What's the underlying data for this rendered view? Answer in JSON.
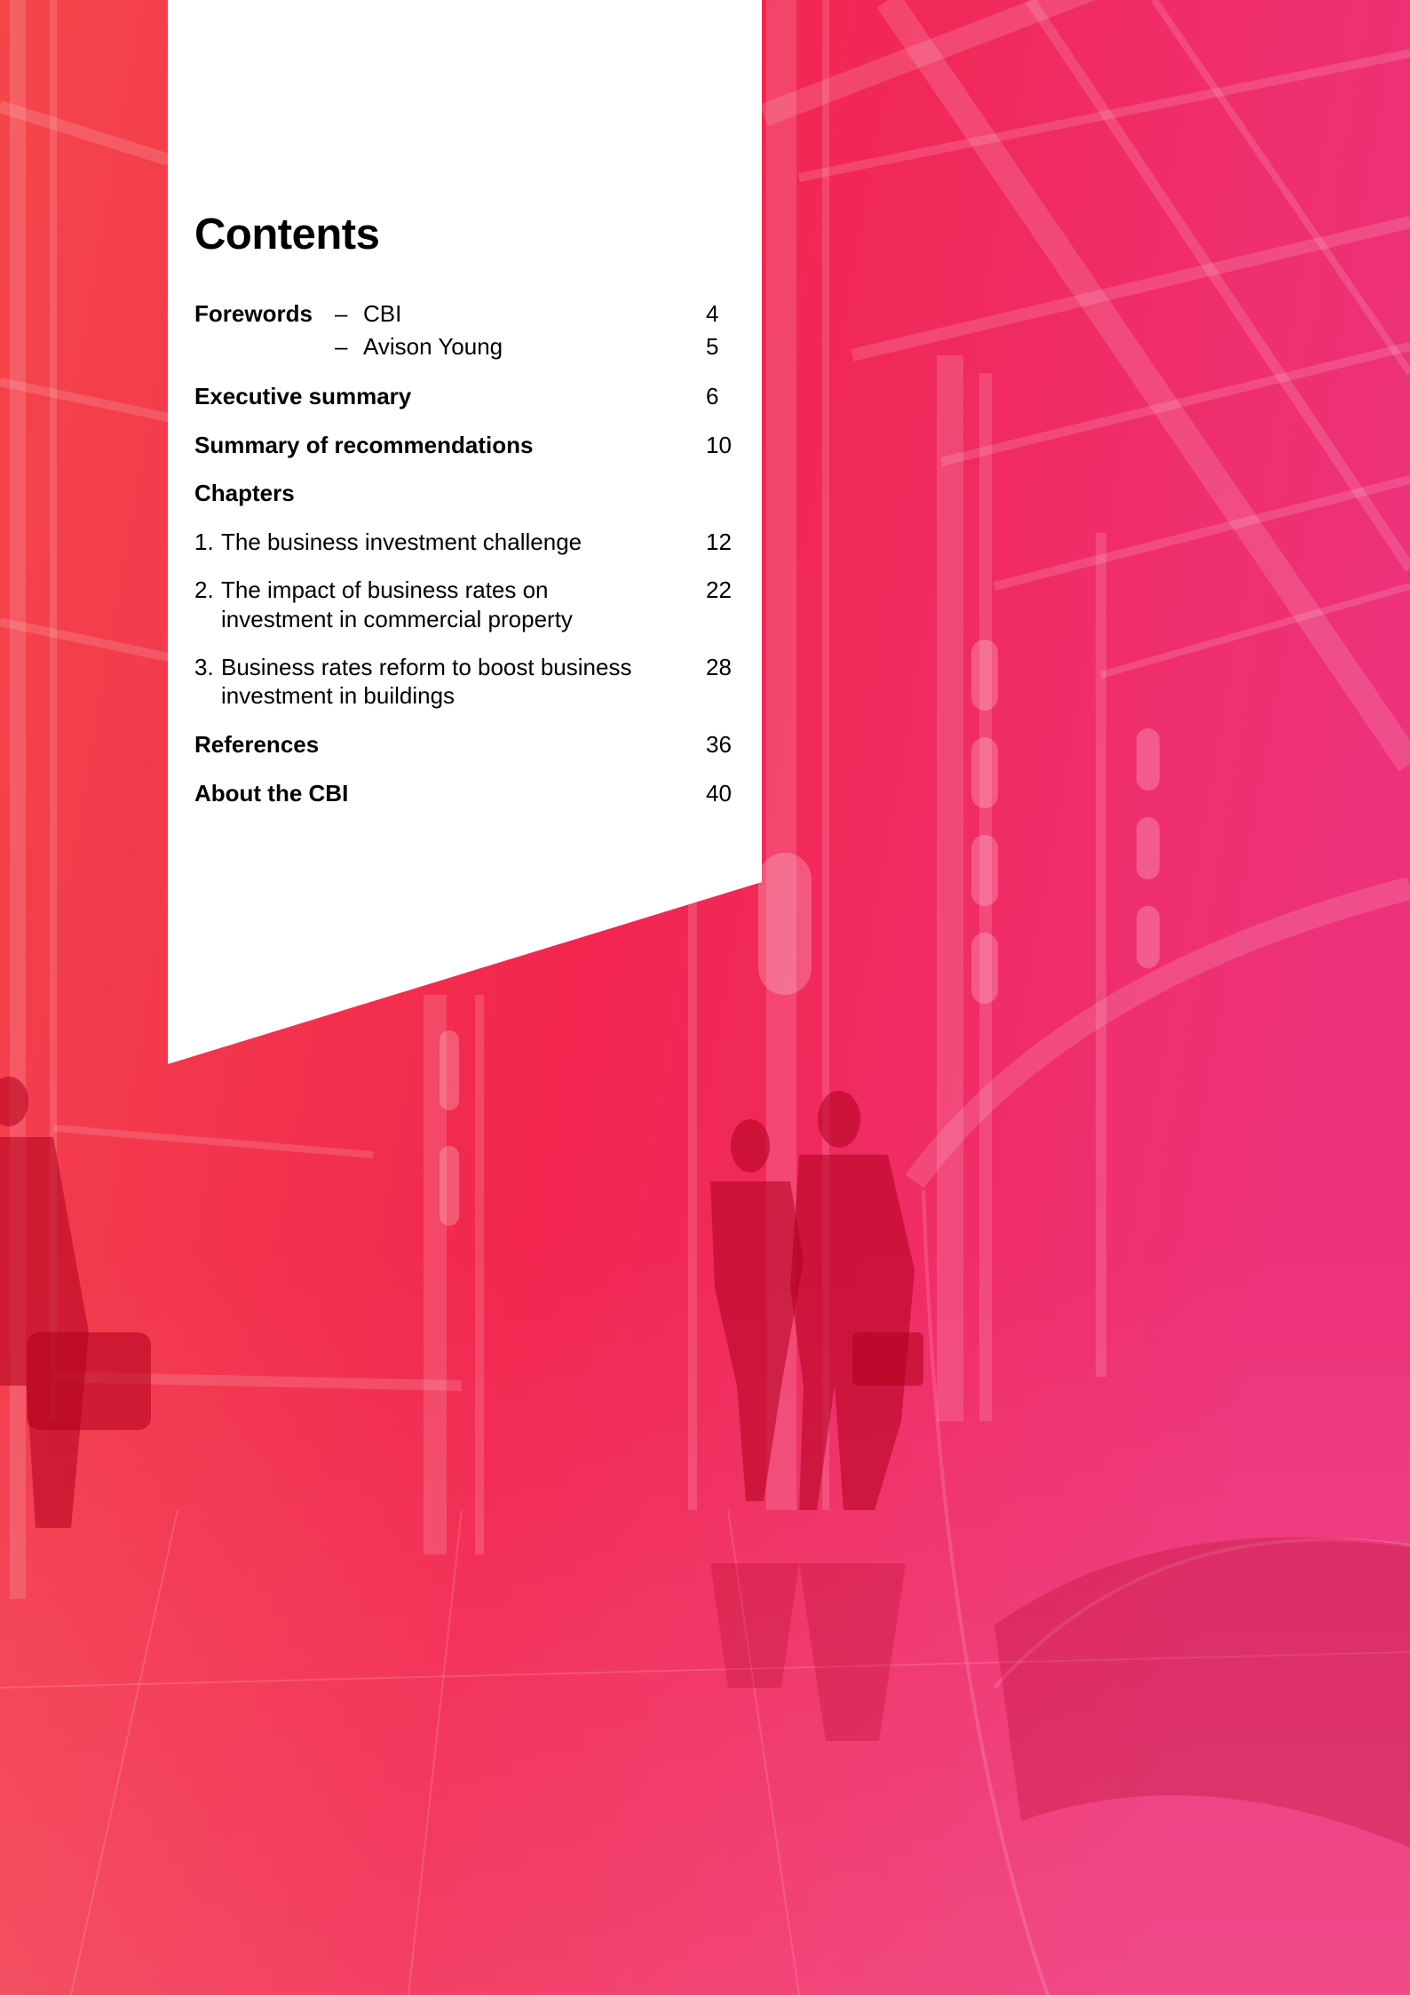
{
  "colors": {
    "gradient_left": "#f44a4c",
    "gradient_mid": "#f2234e",
    "gradient_right": "#ef2f7a",
    "panel": "#ffffff",
    "text": "#000000"
  },
  "background": {
    "description_icon": "photo-background"
  },
  "contents": {
    "title": "Contents",
    "forewords": {
      "label": "Forewords",
      "items": [
        {
          "dash": "–",
          "label": "CBI",
          "page": "4"
        },
        {
          "dash": "–",
          "label": "Avison Young",
          "page": "5"
        }
      ]
    },
    "executive_summary": {
      "label": "Executive summary",
      "page": "6"
    },
    "summary_recommendations": {
      "label": "Summary of recommendations",
      "page": "10"
    },
    "chapters": {
      "label": "Chapters",
      "items": [
        {
          "num": "1.",
          "line1": "The business investment challenge",
          "line2": "",
          "page": "12"
        },
        {
          "num": "2.",
          "line1": "The impact of business rates on",
          "line2": "investment in commercial property",
          "page": "22"
        },
        {
          "num": "3.",
          "line1": "Business rates reform to boost business",
          "line2": "investment in buildings",
          "page": "28"
        }
      ]
    },
    "references": {
      "label": "References",
      "page": "36"
    },
    "about": {
      "label": "About the CBI",
      "page": "40"
    }
  }
}
